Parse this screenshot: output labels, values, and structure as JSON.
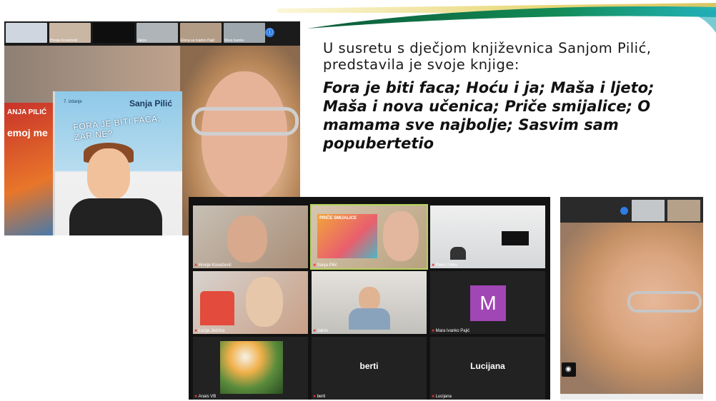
{
  "slide": {
    "intro_line1": "U susretu s dječjom književnica Sanjom Pilić,",
    "intro_line2": "predstavila je svoje knjige:",
    "titles_line1": "Fora je biti faca; Hoću i ja; Maša i ljeto;",
    "titles_line2": "Maša i nova učenica; Priče smijalice; O",
    "titles_line3": "mamama sve najbolje; Sasvim sam",
    "titles_line4": "popubertetio"
  },
  "screenshot1": {
    "strip_thumbs": [
      "",
      "Hrvoje Kovačević",
      "",
      "Jakov",
      "Elona sa Ivanko Pajić",
      "Mara Ivanko"
    ],
    "book": {
      "author": "Sanja Pilić",
      "edition": "7. izdanje",
      "title": "FORA JE BITI FACA, ZAR NE?",
      "second_book_title_part1": "ANJA PILIĆ",
      "second_book_title_part2": "emoj me"
    }
  },
  "screenshot2": {
    "tiles": [
      {
        "label": "Hrvoje Kovačević"
      },
      {
        "label": "Sanja Pilić"
      },
      {
        "label": "Peko i Niko"
      },
      {
        "label": "Lucija Jedrica"
      },
      {
        "label": "Jakov"
      },
      {
        "label": "Mara Ivanko Pajić",
        "avatar_letter": "M"
      },
      {
        "label": "Anais VB"
      },
      {
        "label": "berti",
        "display_name": "berti"
      },
      {
        "label": "Lucijana",
        "display_name": "Lucijana"
      }
    ],
    "book_title": "PRIČE SMIJALICE"
  },
  "colors": {
    "swoosh_green": "#0e7a4c",
    "swoosh_teal": "#1fa8b4",
    "swoosh_yellow": "#e8d87a",
    "highlight": "#b4d35d",
    "avatar_purple": "#a147b5",
    "info_blue": "#2f7de1"
  }
}
